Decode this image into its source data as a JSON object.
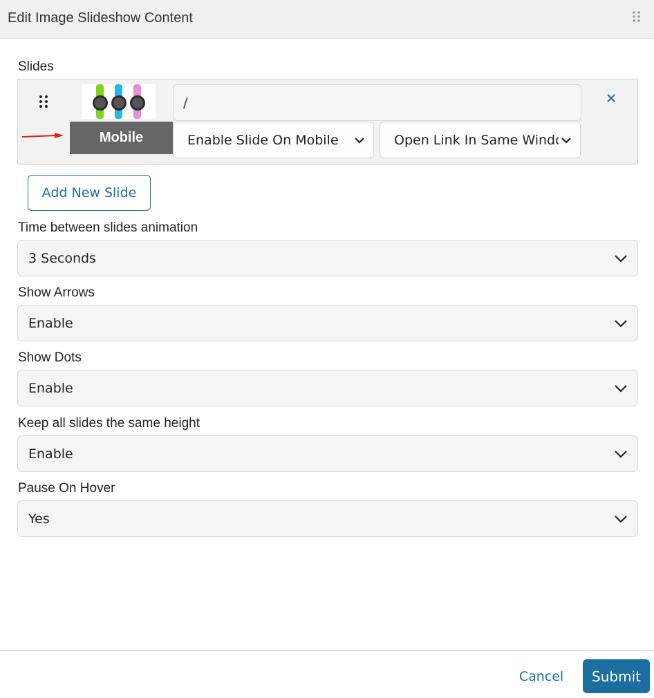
{
  "dialog": {
    "title": "Edit Image Slideshow Content"
  },
  "slides_section": {
    "label": "Slides",
    "items": [
      {
        "thumbnail_icon": "watch-product-image",
        "badge": "Mobile",
        "link_value": "/",
        "mobile_option": "Enable Slide On Mobile",
        "window_option": "Open Link In Same Window"
      }
    ],
    "add_button": "Add New Slide"
  },
  "fields": [
    {
      "label": "Time between slides animation",
      "value": "3 Seconds"
    },
    {
      "label": "Show Arrows",
      "value": "Enable"
    },
    {
      "label": "Show Dots",
      "value": "Enable"
    },
    {
      "label": "Keep all slides the same height",
      "value": "Enable"
    },
    {
      "label": "Pause On Hover",
      "value": "Yes"
    }
  ],
  "footer": {
    "cancel": "Cancel",
    "submit": "Submit"
  },
  "colors": {
    "accent": "#1b6fa0",
    "badge_bg": "#666666",
    "arrow_red": "#e0201b",
    "watch_green": "#7ed321",
    "watch_blue": "#29b6e8",
    "watch_pink": "#e58fd6"
  }
}
